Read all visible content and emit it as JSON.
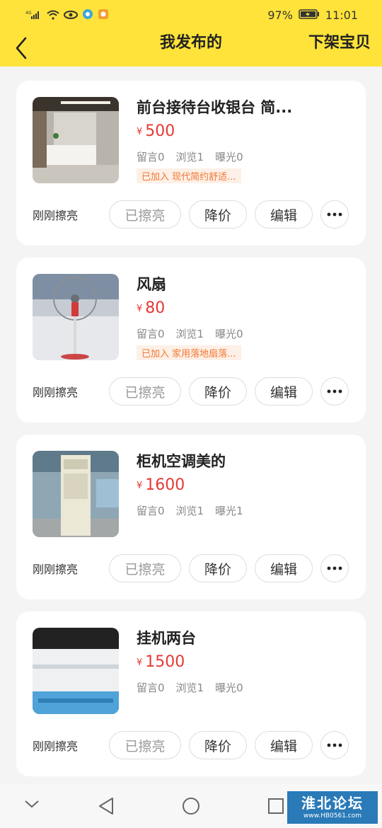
{
  "status_bar": {
    "battery": "97%",
    "time": "11:01",
    "signal": "4G"
  },
  "header": {
    "title": "我发布的",
    "right_action": "下架宝贝"
  },
  "items": [
    {
      "name": "前台接待台收银台 简...",
      "currency": "¥",
      "price": "500",
      "comments": "留言0",
      "views": "浏览1",
      "exposure": "曝光0",
      "tag": "已加入 现代简约舒适...",
      "refresh_time": "刚刚擦亮",
      "btn_polished": "已擦亮",
      "btn_reduce": "降价",
      "btn_edit": "编辑"
    },
    {
      "name": "风扇",
      "currency": "¥",
      "price": "80",
      "comments": "留言0",
      "views": "浏览1",
      "exposure": "曝光0",
      "tag": "已加入 家用落地扇落...",
      "refresh_time": "刚刚擦亮",
      "btn_polished": "已擦亮",
      "btn_reduce": "降价",
      "btn_edit": "编辑"
    },
    {
      "name": "柜机空调美的",
      "currency": "¥",
      "price": "1600",
      "comments": "留言0",
      "views": "浏览1",
      "exposure": "曝光1",
      "tag": null,
      "refresh_time": "刚刚擦亮",
      "btn_polished": "已擦亮",
      "btn_reduce": "降价",
      "btn_edit": "编辑"
    },
    {
      "name": "挂机两台",
      "currency": "¥",
      "price": "1500",
      "comments": "留言0",
      "views": "浏览1",
      "exposure": "曝光0",
      "tag": null,
      "refresh_time": "刚刚擦亮",
      "btn_polished": "已擦亮",
      "btn_reduce": "降价",
      "btn_edit": "编辑"
    }
  ],
  "watermark": {
    "main": "淮北论坛",
    "sub": "www.HB0561.com"
  },
  "colors": {
    "accent": "#ffe33a",
    "price": "#e53935",
    "tag_text": "#f27635",
    "tag_bg": "#fdf0e6"
  },
  "icons": [
    "back-arrow-icon",
    "more-icon",
    "nav-collapse-icon",
    "nav-back-icon",
    "nav-home-icon",
    "nav-recents-icon"
  ]
}
